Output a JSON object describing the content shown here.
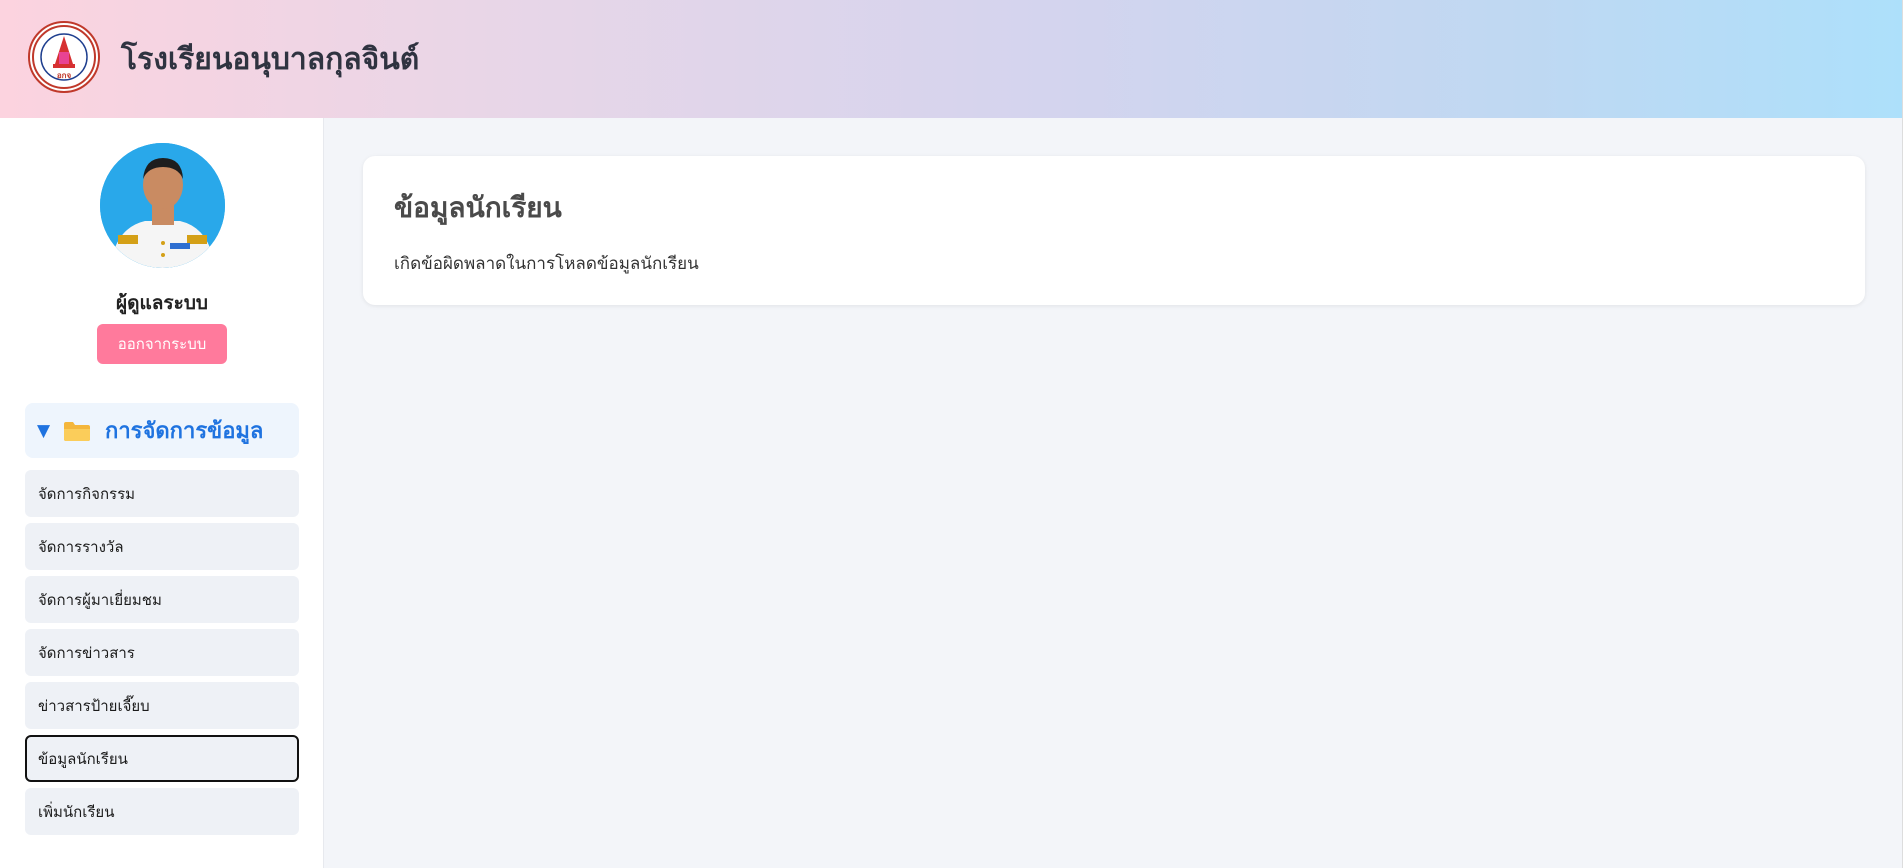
{
  "header": {
    "site_title": "โรงเรียนอนุบาลกุลจินต์",
    "logo_icon": "school-crest-logo"
  },
  "sidebar": {
    "profile_name": "ผู้ดูแลระบบ",
    "logout_label": "ออกจากระบบ",
    "menu_group": {
      "label": "การจัดการข้อมูล",
      "toggle_symbol": "▼",
      "icon": "folder-icon"
    },
    "items": [
      {
        "label": "จัดการกิจกรรม"
      },
      {
        "label": "จัดการรางวัล"
      },
      {
        "label": "จัดการผู้มาเยี่ยมชม"
      },
      {
        "label": "จัดการข่าวสาร"
      },
      {
        "label": "ข่าวสารป้ายเจี๊ยบ"
      },
      {
        "label": "ข้อมูลนักเรียน"
      },
      {
        "label": "เพิ่มนักเรียน"
      }
    ],
    "active_item": "ข้อมูลนักเรียน"
  },
  "main": {
    "card_title": "ข้อมูลนักเรียน",
    "message": "เกิดข้อผิดพลาดในการโหลดข้อมูลนักเรียน"
  },
  "colors": {
    "accent_blue": "#1f73e0",
    "logout_pink": "#ff7a9c",
    "avatar_bg": "#29a8ea"
  }
}
